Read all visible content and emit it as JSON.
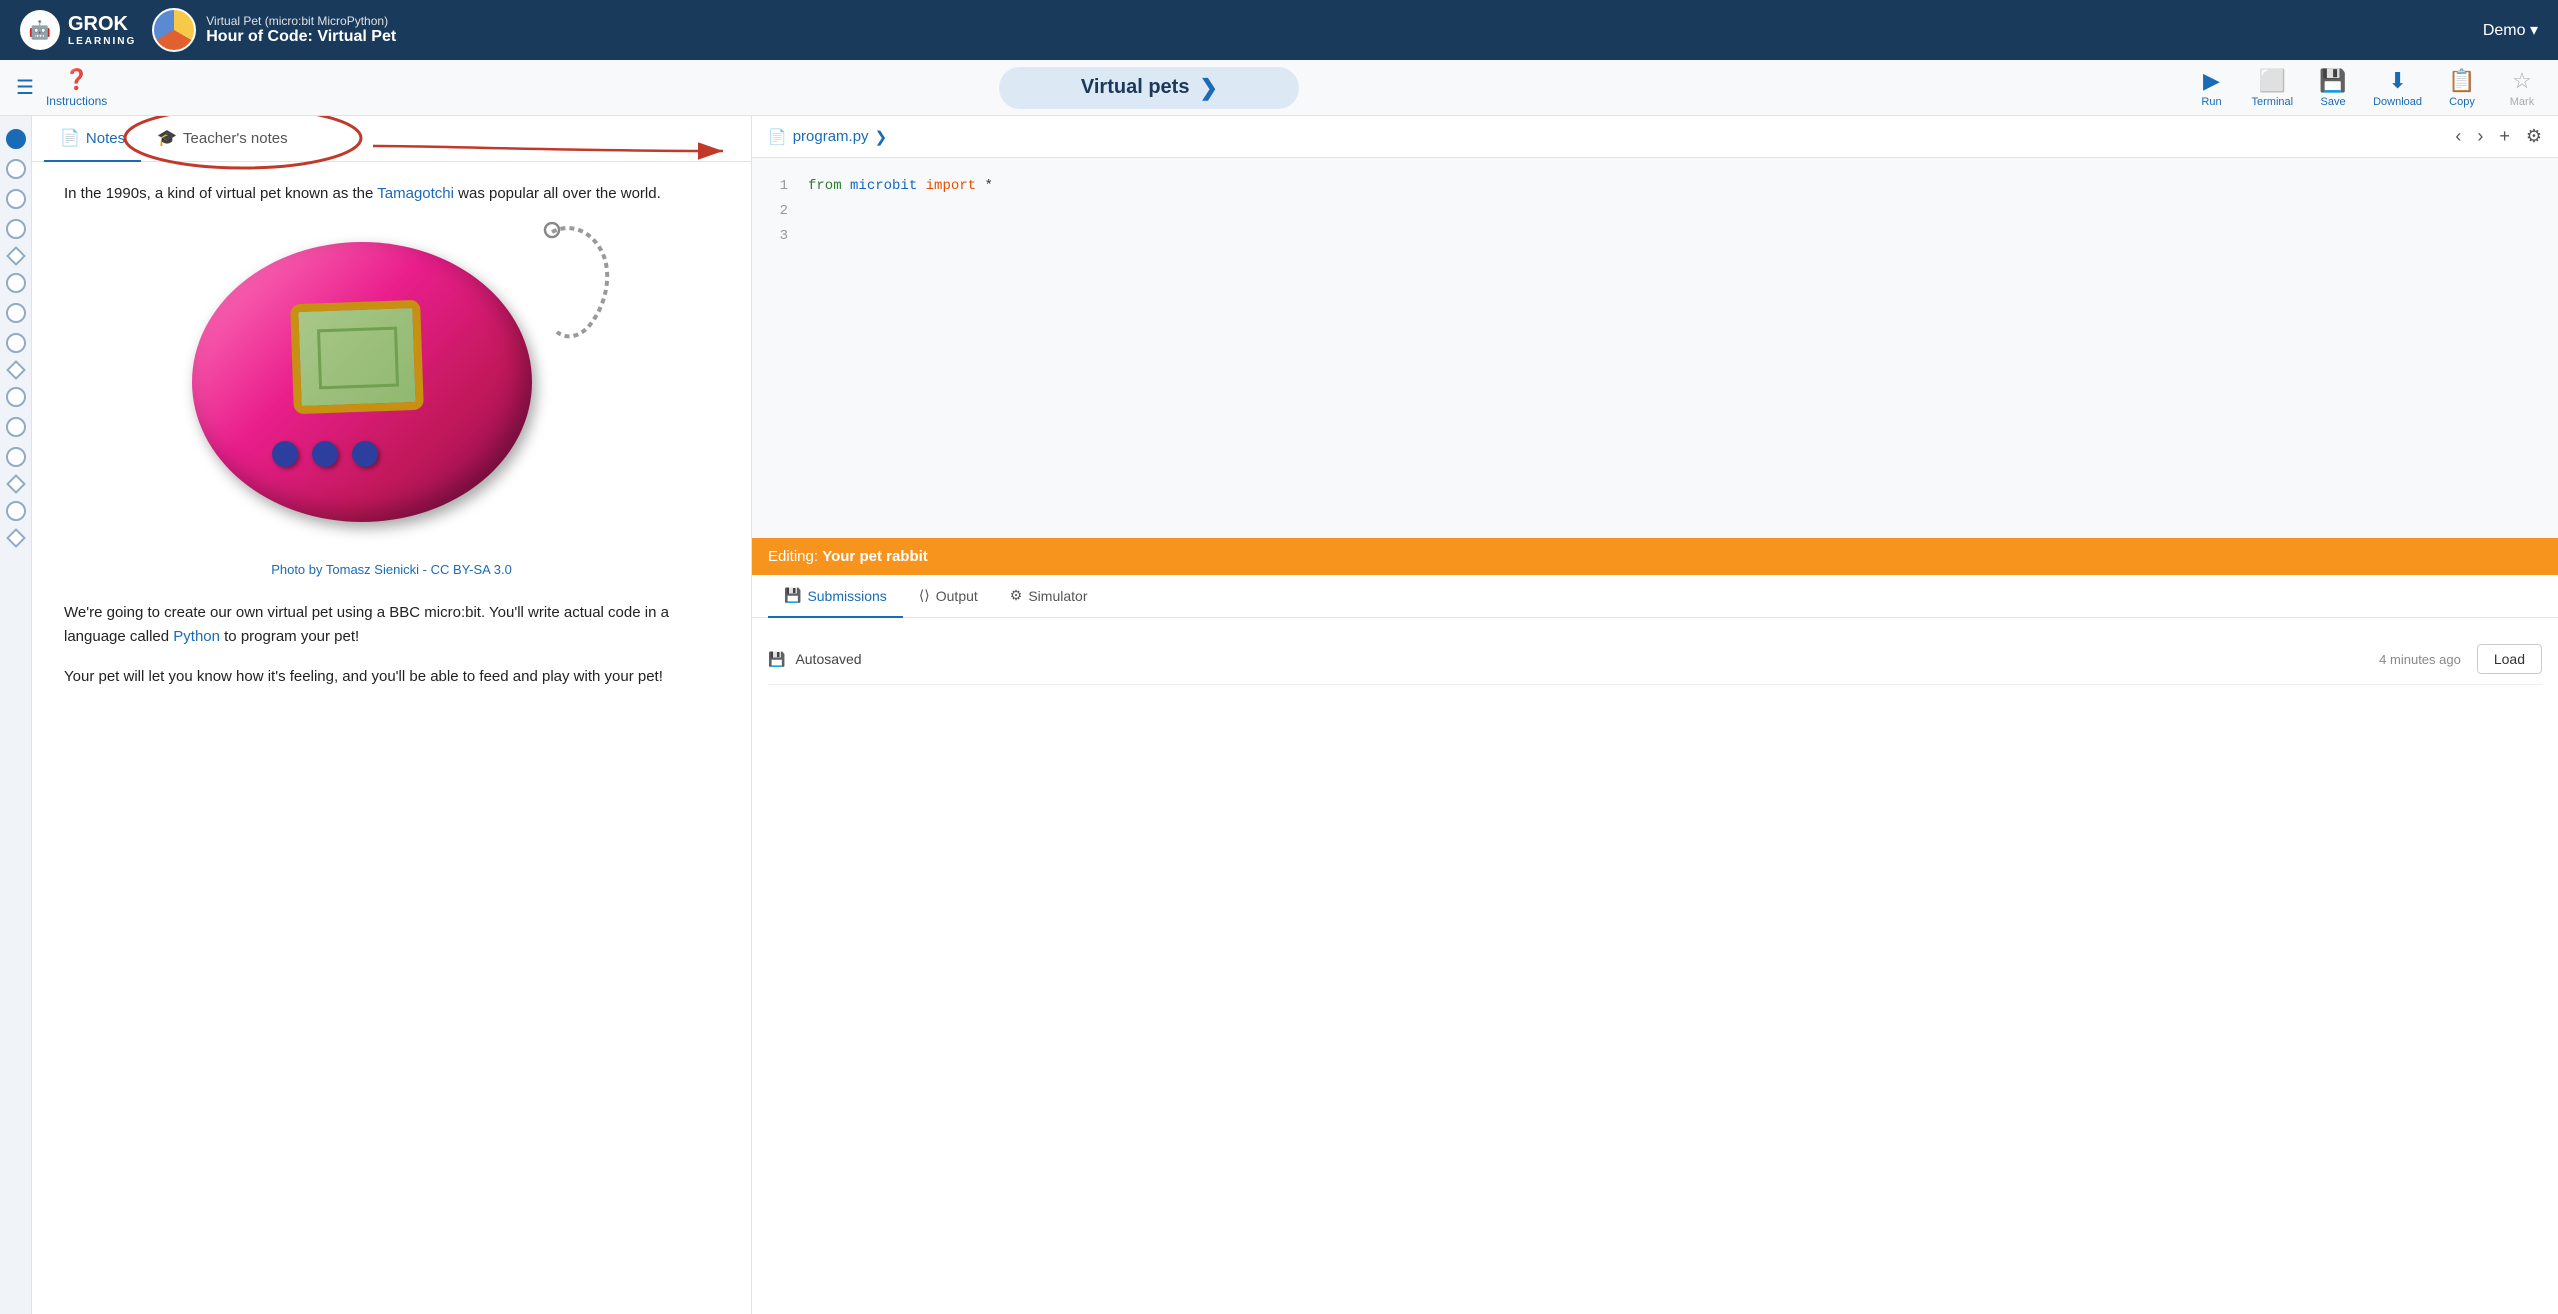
{
  "header": {
    "logo_grok": "GROK",
    "logo_learning": "LEARNING",
    "course_supertitle": "Virtual Pet (micro:bit MicroPython)",
    "course_title": "Hour of Code: Virtual Pet",
    "demo_label": "Demo ▾"
  },
  "toolbar": {
    "instructions_label": "Instructions",
    "title": "Virtual pets",
    "run_label": "Run",
    "terminal_label": "Terminal",
    "save_label": "Save",
    "download_label": "Download",
    "copy_label": "Copy",
    "mark_label": "Mark"
  },
  "tabs": {
    "notes_label": "Notes",
    "teachers_notes_label": "Teacher's notes"
  },
  "content": {
    "paragraph1": "In the 1990s, a kind of virtual pet known as the ",
    "tamagotchi_link": "Tamagotchi",
    "paragraph1_end": " was popular all over the world.",
    "image_caption": "Photo by Tomasz Sienicki - CC BY-SA 3.0",
    "paragraph2_start": "We're going to create our own virtual pet using a BBC micro:bit. You'll write actual code in a language called ",
    "python_link": "Python",
    "paragraph2_end": " to program your pet!",
    "paragraph3": "Your pet will let you know how it's feeling, and you'll be able to feed and play with your pet!"
  },
  "code": {
    "filename": "program.py",
    "lines": [
      {
        "num": "1",
        "content": "from microbit import *"
      },
      {
        "num": "2",
        "content": ""
      },
      {
        "num": "3",
        "content": ""
      }
    ],
    "keywords": {
      "from": "from",
      "microbit": "microbit",
      "import": "import",
      "star": "*"
    }
  },
  "editing_bar": {
    "label": "Editing:",
    "project": "Your pet rabbit"
  },
  "bottom_tabs": {
    "submissions": "Submissions",
    "output": "Output",
    "simulator": "Simulator"
  },
  "submissions": {
    "autosaved_label": "Autosaved",
    "time_ago": "4 minutes ago",
    "load_label": "Load"
  },
  "step_nav": {
    "steps": [
      {
        "type": "circle",
        "active": true
      },
      {
        "type": "circle"
      },
      {
        "type": "circle"
      },
      {
        "type": "circle"
      },
      {
        "type": "diamond"
      },
      {
        "type": "circle"
      },
      {
        "type": "circle"
      },
      {
        "type": "circle"
      },
      {
        "type": "diamond"
      },
      {
        "type": "circle"
      },
      {
        "type": "circle"
      },
      {
        "type": "circle"
      },
      {
        "type": "diamond"
      },
      {
        "type": "circle"
      },
      {
        "type": "diamond"
      }
    ]
  }
}
